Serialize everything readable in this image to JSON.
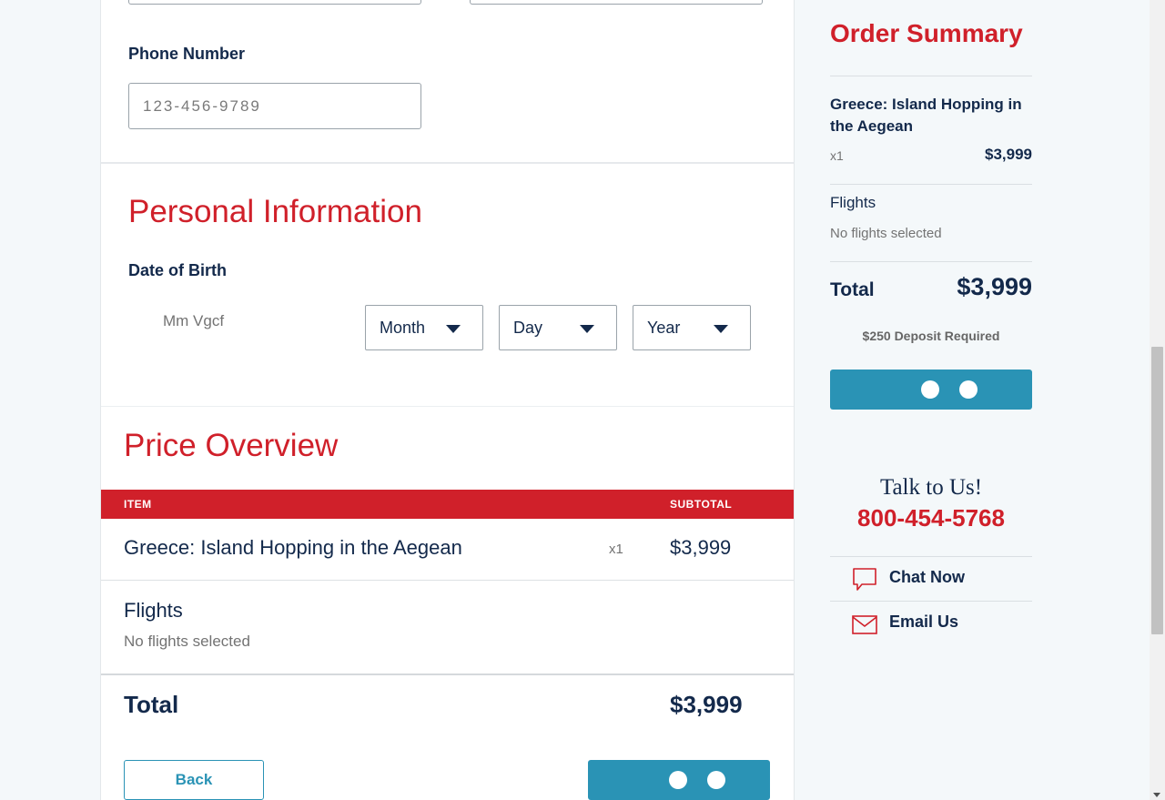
{
  "form": {
    "phone": {
      "label": "Phone Number",
      "placeholder": "123-456-9789",
      "value": ""
    }
  },
  "personal": {
    "title": "Personal Information",
    "dob_label": "Date of Birth",
    "dob_hint": "Mm Vgcf",
    "selects": {
      "month": "Month",
      "day": "Day",
      "year": "Year"
    }
  },
  "price_overview": {
    "title": "Price Overview",
    "header": {
      "item": "ITEM",
      "subtotal": "SUBTOTAL"
    },
    "trip": {
      "name": "Greece: Island Hopping in the Aegean",
      "qty": "x1",
      "price": "$3,999"
    },
    "flights": {
      "label": "Flights",
      "detail": "No flights selected"
    },
    "total": {
      "label": "Total",
      "value": "$3,999"
    },
    "back_label": "Back"
  },
  "order_summary": {
    "title": "Order Summary",
    "trip": {
      "name": "Greece: Island Hopping in the Aegean",
      "qty": "x1",
      "price": "$3,999"
    },
    "flights": {
      "label": "Flights",
      "detail": "No flights selected"
    },
    "total": {
      "label": "Total",
      "value": "$3,999"
    },
    "deposit": "$250 Deposit Required"
  },
  "contact": {
    "heading": "Talk to Us!",
    "phone": "800-454-5768",
    "chat": "Chat Now",
    "email": "Email Us"
  },
  "colors": {
    "accent_red": "#d0202a",
    "primary_blue": "#2a93b5",
    "navy_text": "#13294b",
    "page_bg": "#f4f8fa"
  },
  "icons": {
    "chat": "chat-bubble-icon",
    "email": "envelope-icon",
    "select_caret": "caret-down-icon",
    "loading": "loading-dots-icon"
  }
}
